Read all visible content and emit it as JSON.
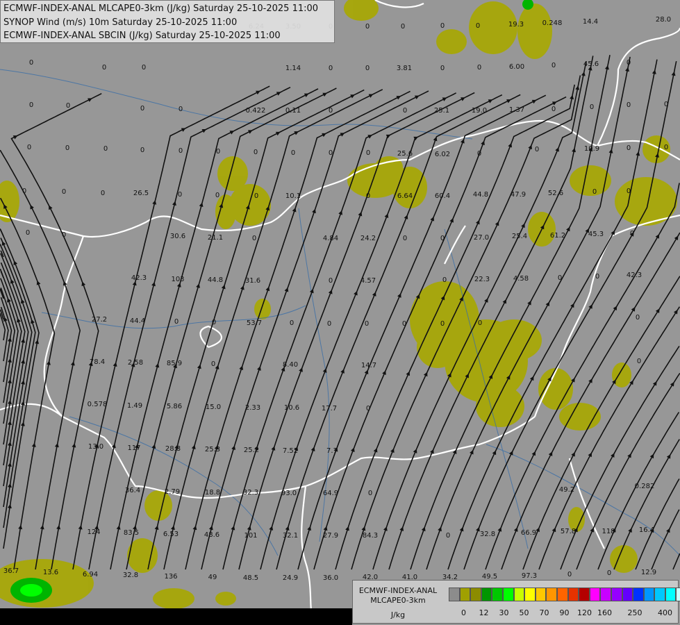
{
  "header": {
    "line1": "ECMWF-INDEX-ANAL MLCAPE0-3km (J/kg) Saturday 25-10-2025 11:00",
    "line2": "SYNOP Wind (m/s) 10m Saturday 25-10-2025 11:00",
    "line3": "ECMWF-INDEX-ANAL SBCIN (J/kg) Saturday 25-10-2025 11:00"
  },
  "legend": {
    "title1": "ECMWF-INDEX-ANAL",
    "title2": "MLCAPE0-3km",
    "unit": "J/kg",
    "colors": [
      "#8c8c8c",
      "#a0a000",
      "#8c8c00",
      "#009600",
      "#00c800",
      "#00ff00",
      "#c8ff00",
      "#ffff00",
      "#ffc800",
      "#ff9600",
      "#ff6400",
      "#e63200",
      "#b40000",
      "#ff00ff",
      "#c800ff",
      "#9600ff",
      "#6400ff",
      "#0032ff",
      "#0096ff",
      "#00c8ff",
      "#00ffff",
      "#c8ffff",
      "#ffffff"
    ],
    "ticks": [
      "0",
      "12",
      "30",
      "50",
      "70",
      "90",
      "120",
      "160",
      "250",
      "400"
    ]
  },
  "values": [
    "28.0",
    "14.4",
    "0.248",
    "19.3",
    "0",
    "0",
    "0",
    "6.24",
    "3.50",
    "0",
    "0",
    "0",
    "0",
    "0",
    "1.14",
    "0",
    "0",
    "3.81",
    "0",
    "0",
    "6.00",
    "0",
    "45.6",
    "0",
    "0",
    "0",
    "0",
    "0",
    "0.422",
    "0.11",
    "0",
    "0",
    "25.1",
    "19.0",
    "1.37",
    "0",
    "0",
    "0",
    "0",
    "0",
    "0",
    "0",
    "0",
    "0",
    "0",
    "0",
    "0",
    "0",
    "0",
    "25.6",
    "6.02",
    "0",
    "0",
    "10.9",
    "0",
    "0",
    "0",
    "0",
    "0",
    "26.5",
    "0",
    "0",
    "0",
    "10.1",
    "0",
    "6.64",
    "60.4",
    "44.8",
    "47.9",
    "52.6",
    "0",
    "0",
    "0",
    "0",
    "30.6",
    "21.1",
    "0",
    "4.84",
    "24.2",
    "0",
    "0",
    "27.0",
    "25.4",
    "61.2",
    "45.3",
    "0",
    "0",
    "42.3",
    "103",
    "44.8",
    "31.6",
    "0",
    "4.57",
    "0",
    "22.3",
    "4.58",
    "0",
    "42.3",
    "0",
    "27.2",
    "44.4",
    "0",
    "0",
    "53.7",
    "0",
    "0",
    "0",
    "0",
    "0",
    "0",
    "78.4",
    "2.58",
    "85.9",
    "0",
    "8.40",
    "14.7",
    "0",
    "0.578",
    "1.49",
    "5.86",
    "15.0",
    "2.33",
    "10.6",
    "17.7",
    "0",
    "13.0",
    "117",
    "28.8",
    "25.3",
    "25.2",
    "7.52",
    "7.7",
    "36.4",
    "2.79",
    "18.8",
    "32.3",
    "93.0",
    "64.9",
    "0",
    "49.2",
    "0.282",
    "124",
    "83.5",
    "6.53",
    "48.6",
    "101",
    "32.1",
    "27.9",
    "84.3",
    "0",
    "32.8",
    "66.9",
    "57.8",
    "118",
    "16.4",
    "36.7",
    "13.6",
    "6.94",
    "32.8",
    "136",
    "49",
    "48.5",
    "24.9",
    "36.0",
    "42.0",
    "41.0",
    "34.2",
    "49.5",
    "97.3",
    "0",
    "0",
    "12.9"
  ]
}
